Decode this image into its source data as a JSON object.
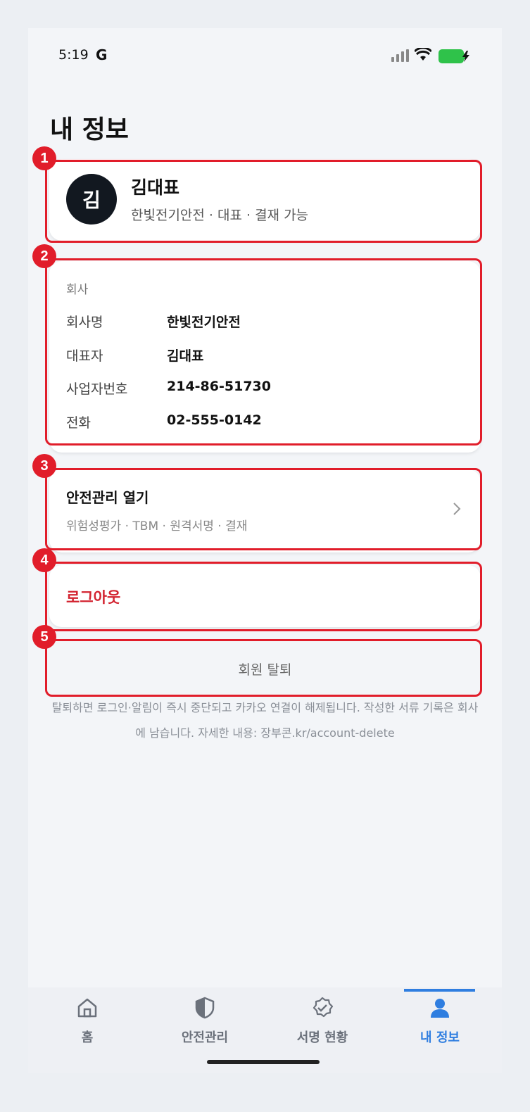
{
  "status_bar": {
    "time": "5:19",
    "g_letter": "G"
  },
  "page": {
    "title": "내 정보"
  },
  "markers": [
    "1",
    "2",
    "3",
    "4",
    "5"
  ],
  "profile": {
    "avatar_letter": "김",
    "name": "김대표",
    "subtitle": "한빛전기안전 · 대표 · 결재 가능"
  },
  "company": {
    "section_label": "회사",
    "rows": [
      {
        "key": "회사명",
        "value": "한빛전기안전"
      },
      {
        "key": "대표자",
        "value": "김대표"
      },
      {
        "key": "사업자번호",
        "value": "214-86-51730"
      },
      {
        "key": "전화",
        "value": "02-555-0142"
      }
    ]
  },
  "safety": {
    "title": "안전관리 열기",
    "subtitle": "위험성평가 · TBM · 원격서명 · 결재",
    "icon": "chevron-right-icon"
  },
  "logout": {
    "label": "로그아웃",
    "color": "#d32330"
  },
  "withdraw": {
    "label": "회원 탈퇴",
    "note": "탈퇴하면 로그인·알림이 즉시 중단되고 카카오 연결이 해제됩니다. 작성한 서류 기록은 회사에 남습니다. 자세한 내용: 장부콘.kr/account-delete"
  },
  "tabbar": {
    "tabs": [
      {
        "label": "홈",
        "icon": "home-icon",
        "active": false
      },
      {
        "label": "안전관리",
        "icon": "shield-icon",
        "active": false
      },
      {
        "label": "서명 현황",
        "icon": "check-badge-icon",
        "active": false
      },
      {
        "label": "내 정보",
        "icon": "person-icon",
        "active": true
      }
    ],
    "active_color": "#2f7ee0"
  },
  "colors": {
    "accent": "#2f7ee0",
    "danger": "#d32330",
    "annotation": "#e11d2a"
  }
}
